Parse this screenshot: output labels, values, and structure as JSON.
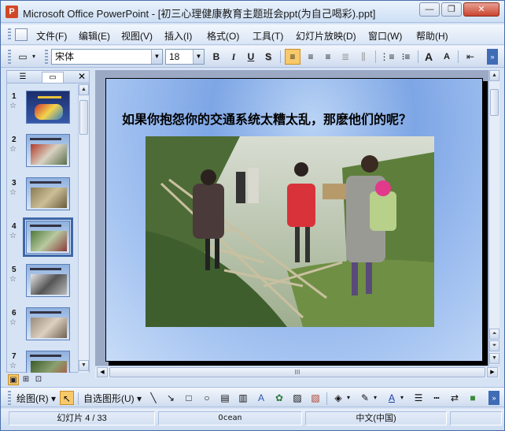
{
  "window": {
    "title": "Microsoft Office PowerPoint - [初三心理健康教育主题班会ppt(为自己喝彩).ppt]",
    "minimize_glyph": "—",
    "restore_glyph": "❐",
    "close_glyph": "✕"
  },
  "menu": {
    "items": [
      {
        "label": "文件(F)"
      },
      {
        "label": "编辑(E)"
      },
      {
        "label": "视图(V)"
      },
      {
        "label": "插入(I)"
      },
      {
        "label": "格式(O)"
      },
      {
        "label": "工具(T)"
      },
      {
        "label": "幻灯片放映(D)"
      },
      {
        "label": "窗口(W)"
      },
      {
        "label": "帮助(H)"
      }
    ]
  },
  "toolbar": {
    "font_name": "宋体",
    "font_size": "18",
    "bold": "B",
    "italic": "I",
    "underline": "U",
    "shadow": "S",
    "grow_font": "A",
    "shrink_font": "A"
  },
  "slide_pane": {
    "close_glyph": "✕",
    "selected_index": 4,
    "thumbnails": [
      {
        "number": "1"
      },
      {
        "number": "2"
      },
      {
        "number": "3"
      },
      {
        "number": "4"
      },
      {
        "number": "5"
      },
      {
        "number": "6"
      },
      {
        "number": "7"
      }
    ]
  },
  "slide": {
    "title": "如果你抱怨你的交通系统太糟太乱，那麽他们的呢？",
    "accent_color": "#7ea6e5"
  },
  "hscroll": {
    "thumb_glyph": "III"
  },
  "drawbar": {
    "draw_label": "绘图(R)",
    "autoshapes_label": "自选图形(U)"
  },
  "status": {
    "slide_info": "幻灯片 4 / 33",
    "design": "Ocean",
    "language": "中文(中国)"
  }
}
